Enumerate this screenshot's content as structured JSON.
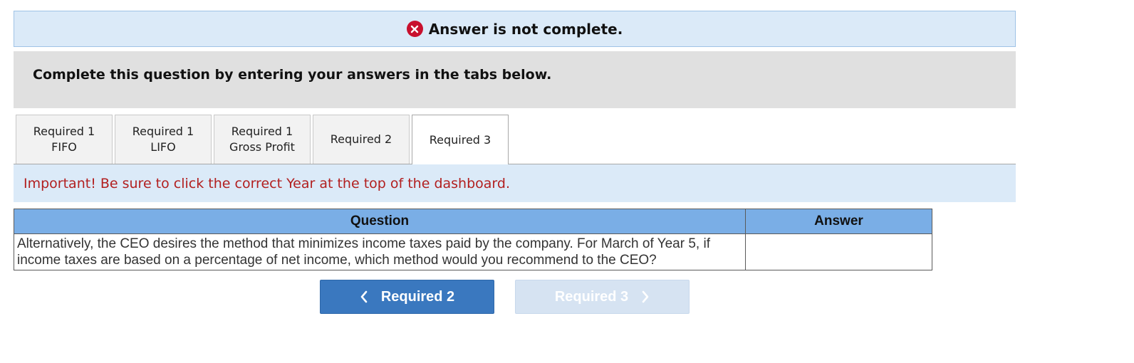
{
  "status": {
    "icon": "x-circle-icon",
    "text": "Answer is not complete.",
    "icon_color": "#c8102e"
  },
  "instruction": {
    "text": "Complete this question by entering your answers in the tabs below."
  },
  "tabs": [
    {
      "line1": "Required 1",
      "line2": "FIFO",
      "active": false
    },
    {
      "line1": "Required 1",
      "line2": "LIFO",
      "active": false
    },
    {
      "line1": "Required 1",
      "line2": "Gross Profit",
      "active": false
    },
    {
      "line1": "Required 2",
      "line2": "",
      "active": false
    },
    {
      "line1": "Required 3",
      "line2": "",
      "active": true
    }
  ],
  "notice": {
    "text": "Important! Be sure to click the correct Year at the top of the dashboard.",
    "color": "#b21f1f"
  },
  "table": {
    "headers": {
      "question": "Question",
      "answer": "Answer"
    },
    "rows": [
      {
        "question": "Alternatively, the CEO desires the method that minimizes income taxes paid by the company. For March of Year 5, if income taxes are based on a percentage of net income, which method would you recommend to the CEO?",
        "answer": ""
      }
    ]
  },
  "navigation": {
    "prev_label": "Required 2",
    "next_label": "Required 3",
    "next_disabled": true
  },
  "colors": {
    "banner_bg": "#dbeaf8",
    "header_bg": "#7aaee6",
    "primary_button": "#3a78bf",
    "disabled_button": "#d6e3f2"
  }
}
